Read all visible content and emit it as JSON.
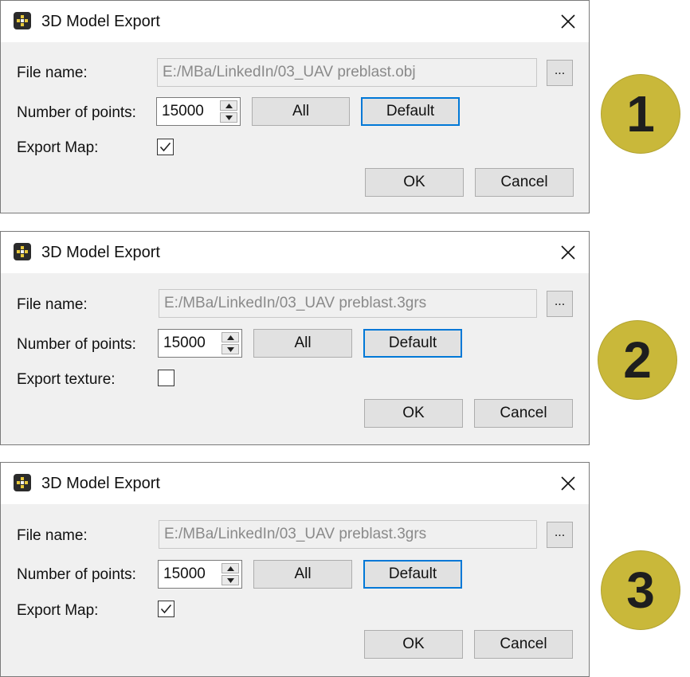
{
  "dialogs": [
    {
      "title": "3D Model Export",
      "file_label": "File name:",
      "file_value": "E:/MBa/LinkedIn/03_UAV preblast.obj",
      "browse_label": "...",
      "points_label": "Number of points:",
      "points_value": "15000",
      "all_label": "All",
      "default_label": "Default",
      "export_label": "Export Map:",
      "export_checked": true,
      "ok_label": "OK",
      "cancel_label": "Cancel"
    },
    {
      "title": "3D Model Export",
      "file_label": "File name:",
      "file_value": "E:/MBa/LinkedIn/03_UAV preblast.3grs",
      "browse_label": "...",
      "points_label": "Number of points:",
      "points_value": "15000",
      "all_label": "All",
      "default_label": "Default",
      "export_label": "Export texture:",
      "export_checked": false,
      "ok_label": "OK",
      "cancel_label": "Cancel"
    },
    {
      "title": "3D Model Export",
      "file_label": "File name:",
      "file_value": "E:/MBa/LinkedIn/03_UAV preblast.3grs",
      "browse_label": "...",
      "points_label": "Number of points:",
      "points_value": "15000",
      "all_label": "All",
      "default_label": "Default",
      "export_label": "Export Map:",
      "export_checked": true,
      "ok_label": "OK",
      "cancel_label": "Cancel"
    }
  ],
  "badges": [
    "1",
    "2",
    "3"
  ],
  "colors": {
    "badge": "#c9b83a",
    "default_border": "#0078d7"
  },
  "icons": {
    "app": "app-grid-icon",
    "close": "close-icon",
    "check": "checkmark-icon",
    "spin_up": "chevron-up-icon",
    "spin_down": "chevron-down-icon"
  }
}
